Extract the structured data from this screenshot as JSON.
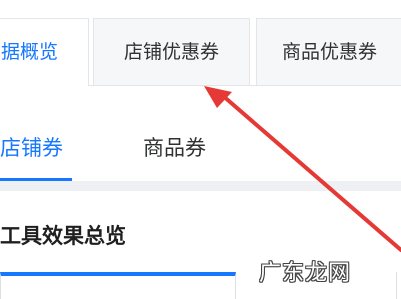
{
  "top_tabs": [
    {
      "label": "据概览",
      "active": true
    },
    {
      "label": "店铺优惠券",
      "active": false
    },
    {
      "label": "商品优惠券",
      "active": false
    }
  ],
  "sub_tabs": [
    {
      "label": "店铺券",
      "active": true
    },
    {
      "label": "商品券",
      "active": false
    }
  ],
  "section_title": "工具效果总览",
  "annotation": {
    "type": "red-arrow-icon",
    "color": "#e53935"
  },
  "watermark": "广东龙网",
  "colors": {
    "accent": "#1677ff",
    "text": "#303133",
    "border": "#e3e5e9",
    "arrow": "#e53935"
  }
}
